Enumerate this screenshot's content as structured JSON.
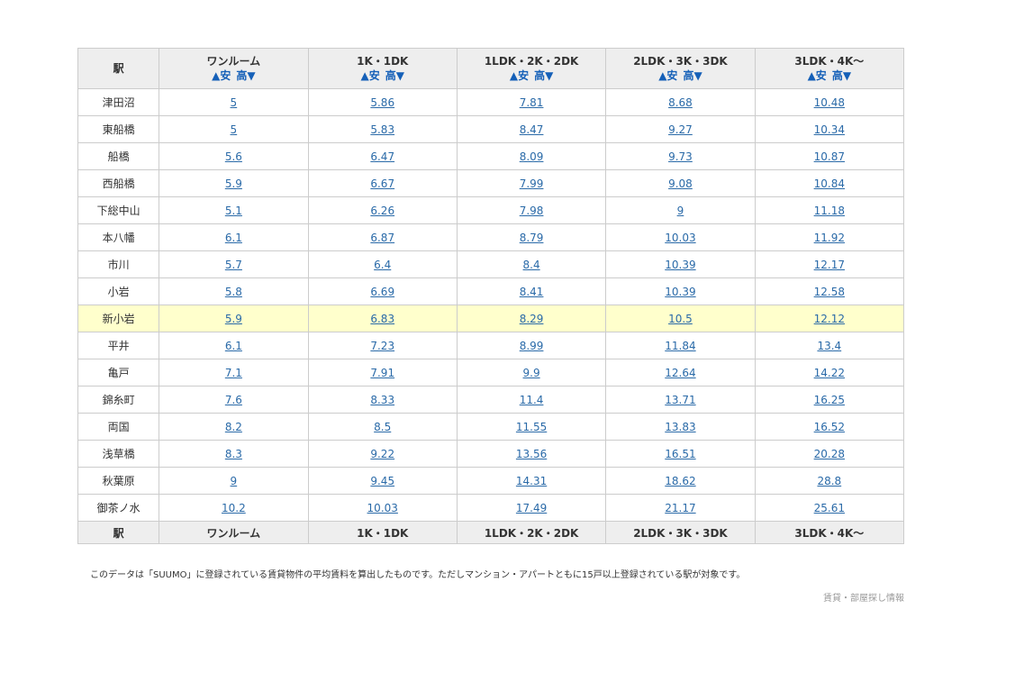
{
  "table": {
    "station_header": "駅",
    "columns": [
      {
        "label": "ワンルーム",
        "sort_low": "▲安",
        "sort_high": "高▼"
      },
      {
        "label": "1K・1DK",
        "sort_low": "▲安",
        "sort_high": "高▼"
      },
      {
        "label": "1LDK・2K・2DK",
        "sort_low": "▲安",
        "sort_high": "高▼"
      },
      {
        "label": "2LDK・3K・3DK",
        "sort_low": "▲安",
        "sort_high": "高▼"
      },
      {
        "label": "3LDK・4K～",
        "sort_low": "▲安",
        "sort_high": "高▼"
      }
    ],
    "highlight_row_index": 8,
    "highlight_color": "#ffffcc",
    "link_color": "#2a6aa8",
    "header_bg": "#eeeeee",
    "rows": [
      {
        "station": "津田沼",
        "values": [
          "5",
          "5.86",
          "7.81",
          "8.68",
          "10.48"
        ]
      },
      {
        "station": "東船橋",
        "values": [
          "5",
          "5.83",
          "8.47",
          "9.27",
          "10.34"
        ]
      },
      {
        "station": "船橋",
        "values": [
          "5.6",
          "6.47",
          "8.09",
          "9.73",
          "10.87"
        ]
      },
      {
        "station": "西船橋",
        "values": [
          "5.9",
          "6.67",
          "7.99",
          "9.08",
          "10.84"
        ]
      },
      {
        "station": "下総中山",
        "values": [
          "5.1",
          "6.26",
          "7.98",
          "9",
          "11.18"
        ]
      },
      {
        "station": "本八幡",
        "values": [
          "6.1",
          "6.87",
          "8.79",
          "10.03",
          "11.92"
        ]
      },
      {
        "station": "市川",
        "values": [
          "5.7",
          "6.4",
          "8.4",
          "10.39",
          "12.17"
        ]
      },
      {
        "station": "小岩",
        "values": [
          "5.8",
          "6.69",
          "8.41",
          "10.39",
          "12.58"
        ]
      },
      {
        "station": "新小岩",
        "values": [
          "5.9",
          "6.83",
          "8.29",
          "10.5",
          "12.12"
        ]
      },
      {
        "station": "平井",
        "values": [
          "6.1",
          "7.23",
          "8.99",
          "11.84",
          "13.4"
        ]
      },
      {
        "station": "亀戸",
        "values": [
          "7.1",
          "7.91",
          "9.9",
          "12.64",
          "14.22"
        ]
      },
      {
        "station": "錦糸町",
        "values": [
          "7.6",
          "8.33",
          "11.4",
          "13.71",
          "16.25"
        ]
      },
      {
        "station": "両国",
        "values": [
          "8.2",
          "8.5",
          "11.55",
          "13.83",
          "16.52"
        ]
      },
      {
        "station": "浅草橋",
        "values": [
          "8.3",
          "9.22",
          "13.56",
          "16.51",
          "20.28"
        ]
      },
      {
        "station": "秋葉原",
        "values": [
          "9",
          "9.45",
          "14.31",
          "18.62",
          "28.8"
        ]
      },
      {
        "station": "御茶ノ水",
        "values": [
          "10.2",
          "10.03",
          "17.49",
          "21.17",
          "25.61"
        ]
      }
    ]
  },
  "note": "このデータは「SUUMO」に登録されている賃貸物件の平均賃料を算出したものです。ただしマンション・アパートともに15戸以上登録されている駅が対象です。",
  "footer_link": "賃貸・部屋探し情報"
}
